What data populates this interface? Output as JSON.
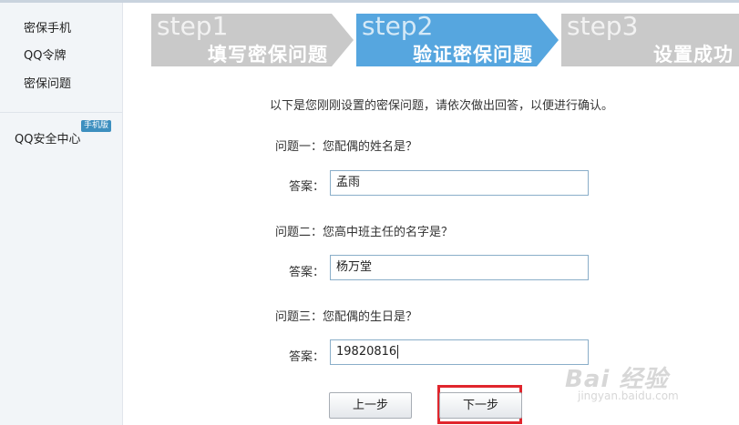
{
  "sidebar": {
    "items": [
      {
        "label": "密保手机"
      },
      {
        "label": "QQ令牌"
      },
      {
        "label": "密保问题"
      }
    ],
    "security_center": "QQ安全中心",
    "mobile_badge": "手机版"
  },
  "steps": [
    {
      "num": "step1",
      "title": "填写密保问题",
      "state": "done"
    },
    {
      "num": "step2",
      "title": "验证密保问题",
      "state": "current"
    },
    {
      "num": "step3",
      "title": "设置成功",
      "state": "pending"
    }
  ],
  "instruction": "以下是您刚刚设置的密保问题，请依次做出回答，以便进行确认。",
  "questions": [
    {
      "label": "问题一：您配偶的姓名是？",
      "answer_label": "答案：",
      "answer": "孟雨"
    },
    {
      "label": "问题二：您高中班主任的名字是？",
      "answer_label": "答案：",
      "answer": "杨万堂"
    },
    {
      "label": "问题三：您配偶的生日是？",
      "answer_label": "答案：",
      "answer": "19820816"
    }
  ],
  "buttons": {
    "prev": "上一步",
    "next": "下一步"
  },
  "watermark": {
    "logo": "Bai 经验",
    "url": "jingyan.baidu.com"
  },
  "colors": {
    "step_current": "#56a6df",
    "step_other": "#c9c9c9",
    "highlight": "#e0262d"
  }
}
